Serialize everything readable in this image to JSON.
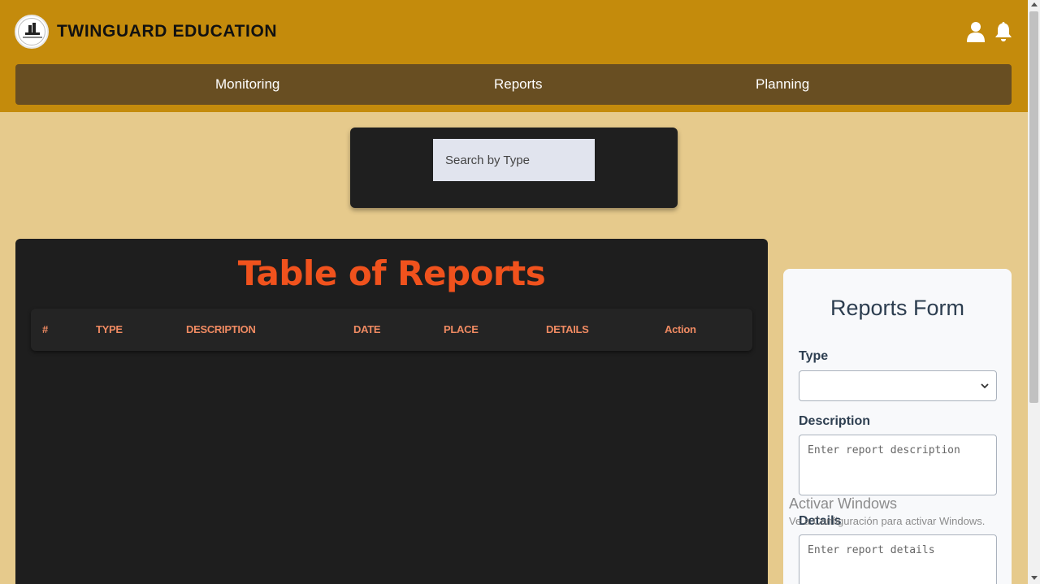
{
  "header": {
    "brand": "TWINGUARD EDUCATION",
    "icons": {
      "user": "user-icon",
      "notifications": "bell-icon"
    }
  },
  "nav": {
    "items": [
      {
        "label": "Monitoring"
      },
      {
        "label": "Reports"
      },
      {
        "label": "Planning"
      }
    ]
  },
  "search": {
    "placeholder": "Search by Type"
  },
  "table": {
    "title": "Table of Reports",
    "columns": [
      "#",
      "TYPE",
      "DESCRIPTION",
      "DATE",
      "PLACE",
      "DETAILS",
      "Action"
    ],
    "rows": []
  },
  "form": {
    "title": "Reports Form",
    "type_label": "Type",
    "type_value": "",
    "description_label": "Description",
    "description_placeholder": "Enter report description",
    "details_label": "Details",
    "details_placeholder": "Enter report details"
  },
  "watermark": {
    "title": "Activar Windows",
    "subtitle": "Ve a Configuración para activar Windows."
  },
  "colors": {
    "header_bg": "#c48b0c",
    "nav_bg": "#684e22",
    "page_bg": "#e6ca8c",
    "panel_bg": "#1e1e1e",
    "title_accent": "#f0521d",
    "column_header": "#ef8a62"
  }
}
